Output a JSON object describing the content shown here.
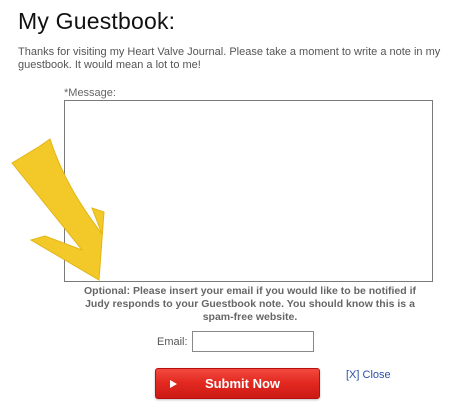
{
  "page": {
    "title": "My Guestbook:",
    "intro": "Thanks for visiting my Heart Valve Journal. Please take a moment to write a note in my guestbook. It would mean a lot to me!"
  },
  "form": {
    "message_label": "*Message:",
    "message_value": "",
    "optional_note": "Optional: Please insert your email if you would like to be notified if Judy responds to your Guestbook note. You should know this is a spam-free website.",
    "email_label": "Email:",
    "email_value": "",
    "submit_label": "Submit Now",
    "close_label": "[X] Close"
  },
  "annotation": {
    "arrow_icon": "arrow-down-right-icon",
    "arrow_color": "#f3c92a"
  },
  "colors": {
    "submit_button": "#e32a21",
    "link": "#2a4fa8",
    "text": "#555555"
  }
}
